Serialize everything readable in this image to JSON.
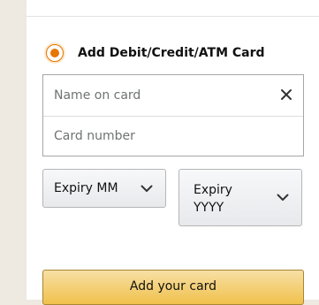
{
  "payment_option": {
    "label": "Add Debit/Credit/ATM Card",
    "selected": true
  },
  "card_form": {
    "name_placeholder": "Name on card",
    "number_placeholder": "Card number",
    "clear_icon": "close-icon"
  },
  "expiry": {
    "month_label": "Expiry MM",
    "year_label": "Expiry YYYY",
    "dropdown_icon": "chevron-down-icon"
  },
  "actions": {
    "add_card_label": "Add your card"
  },
  "colors": {
    "accent_orange": "#e77600",
    "button_yellow": "#f0c14b",
    "border_gray": "#a6a6a6"
  }
}
